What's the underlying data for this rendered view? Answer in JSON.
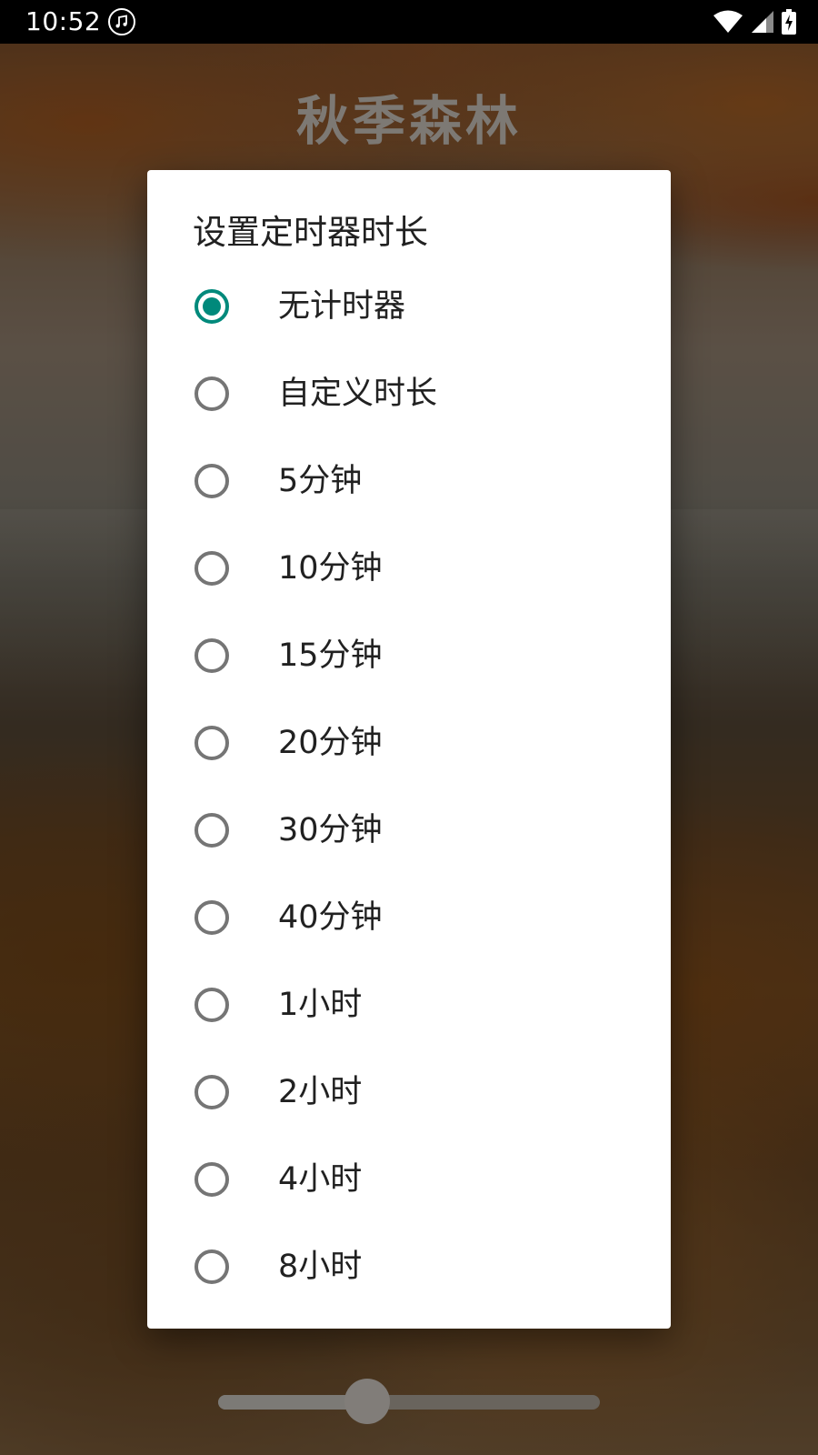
{
  "status_bar": {
    "time": "10:52",
    "icons": [
      "music-note-icon",
      "wifi-icon",
      "cell-signal-icon",
      "battery-charging-icon"
    ]
  },
  "app_bar": {
    "title": "秋季森林"
  },
  "dialog": {
    "title": "设置定时器时长",
    "selected_index": 0,
    "accent_color": "#00897b",
    "options": [
      {
        "label": "无计时器",
        "checked": true
      },
      {
        "label": "自定义时长",
        "checked": false
      },
      {
        "label": "5分钟",
        "checked": false
      },
      {
        "label": "10分钟",
        "checked": false
      },
      {
        "label": "15分钟",
        "checked": false
      },
      {
        "label": "20分钟",
        "checked": false
      },
      {
        "label": "30分钟",
        "checked": false
      },
      {
        "label": "40分钟",
        "checked": false
      },
      {
        "label": "1小时",
        "checked": false
      },
      {
        "label": "2小时",
        "checked": false
      },
      {
        "label": "4小时",
        "checked": false
      },
      {
        "label": "8小时",
        "checked": false
      }
    ]
  },
  "volume_slider": {
    "value_fraction": 0.39
  }
}
